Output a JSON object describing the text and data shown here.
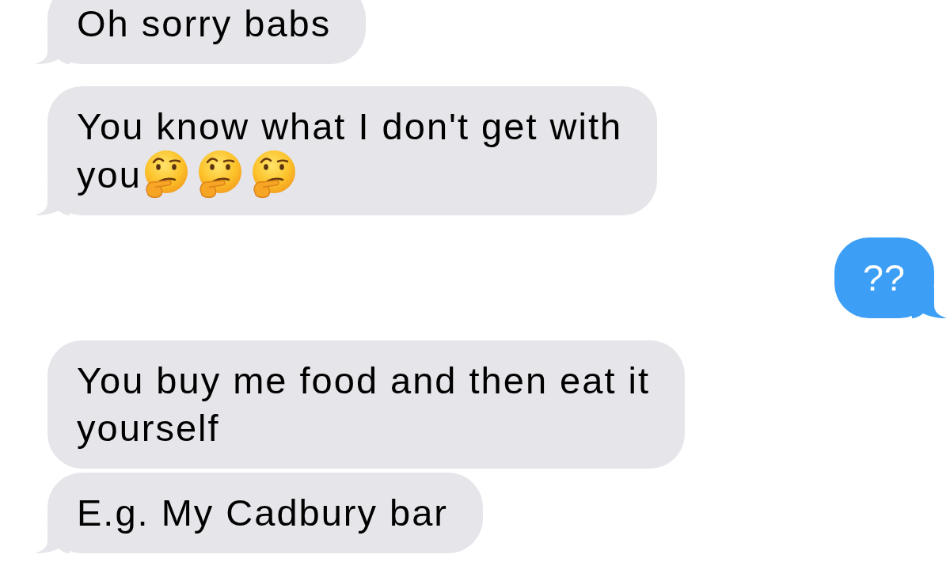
{
  "messages": [
    {
      "kind": "received",
      "lines": [
        "Oh sorry babs"
      ],
      "tail": true
    },
    {
      "kind": "received",
      "lines": [
        "You know what I don't get with",
        "you"
      ],
      "emojis": [
        {
          "kind": "thinking"
        },
        {
          "kind": "thinking"
        },
        {
          "kind": "thinking"
        }
      ],
      "tail": true
    },
    {
      "kind": "sent",
      "lines": [
        "??"
      ],
      "tail": true
    },
    {
      "kind": "received",
      "lines": [
        "You buy me food and then eat it",
        "yourself"
      ],
      "tail": false
    },
    {
      "kind": "received",
      "lines": [
        "E.g. My Cadbury bar"
      ],
      "tail": true
    }
  ]
}
